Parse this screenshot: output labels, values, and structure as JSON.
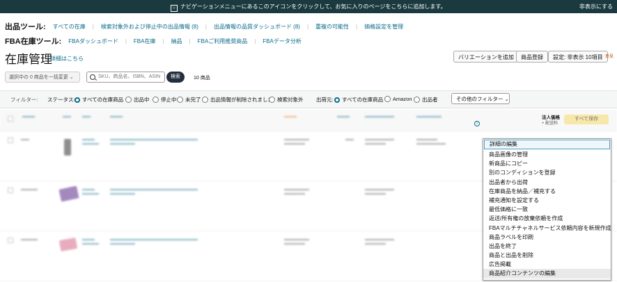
{
  "banner": {
    "message": "ナビゲーションメニューにあるこのアイコンをクリックして、お気に入りのページをこちらに追加します。",
    "hide": "非表示にする"
  },
  "listing_tools": {
    "label": "出品ツール:",
    "links": [
      "すべての在庫",
      "検索対象外および停止中の出品情報 (8)",
      "出品情報の品質ダッシュボード (8)",
      "重複の可能性",
      "価格設定を管理"
    ]
  },
  "fba_tools": {
    "label": "FBA在庫ツール:",
    "links": [
      "FBAダッシュボード",
      "FBA在庫",
      "納品",
      "FBAご利用推奨商品",
      "FBAデータ分析"
    ]
  },
  "page": {
    "title": "在庫管理",
    "detail_link": "詳細はこちら",
    "add_variation": "バリエーションを追加",
    "register": "商品登録",
    "settings": "設定: 非表示 10項目",
    "feedback": "意見"
  },
  "bulk": {
    "label": "選択中の 0 商品を一括変更"
  },
  "search": {
    "placeholder": "SKU、商品名、ISBN、ASIN",
    "button": "検索",
    "count": "10 商品"
  },
  "filters": {
    "label": "フィルター:",
    "status_label": "ステータス:",
    "status_options": [
      "すべての在庫商品",
      "出品中",
      "停止中",
      "未完了",
      "出品情報が削除されました",
      "検索対象外"
    ],
    "fulfill_label": "出荷元:",
    "fulfill_options": [
      "すべての在庫商品",
      "Amazon",
      "出品者"
    ],
    "more": "その他のフィルター"
  },
  "table": {
    "business_price": "法人価格",
    "shipping": "+ 配送料",
    "save_all": "すべて保存"
  },
  "menu": {
    "items": [
      "詳細の編集",
      "商品画像の管理",
      "新商品にコピー",
      "別のコンディションを登録",
      "出品者から出荷",
      "在庫商品を納品／補充する",
      "補充通知を設定する",
      "最低価格に一致",
      "返送/所有権の放棄依頼を作成",
      "FBAマルチチャネルサービス依頼内容を新規作成",
      "商品ラベルを印刷",
      "出品を終了",
      "商品と出品を削除",
      "広告掲載",
      "商品紹介コンテンツの編集"
    ]
  },
  "colors": {
    "accent": "#0a6a8a",
    "topbar": "#1b3a3f",
    "save": "#f7e7a8"
  }
}
